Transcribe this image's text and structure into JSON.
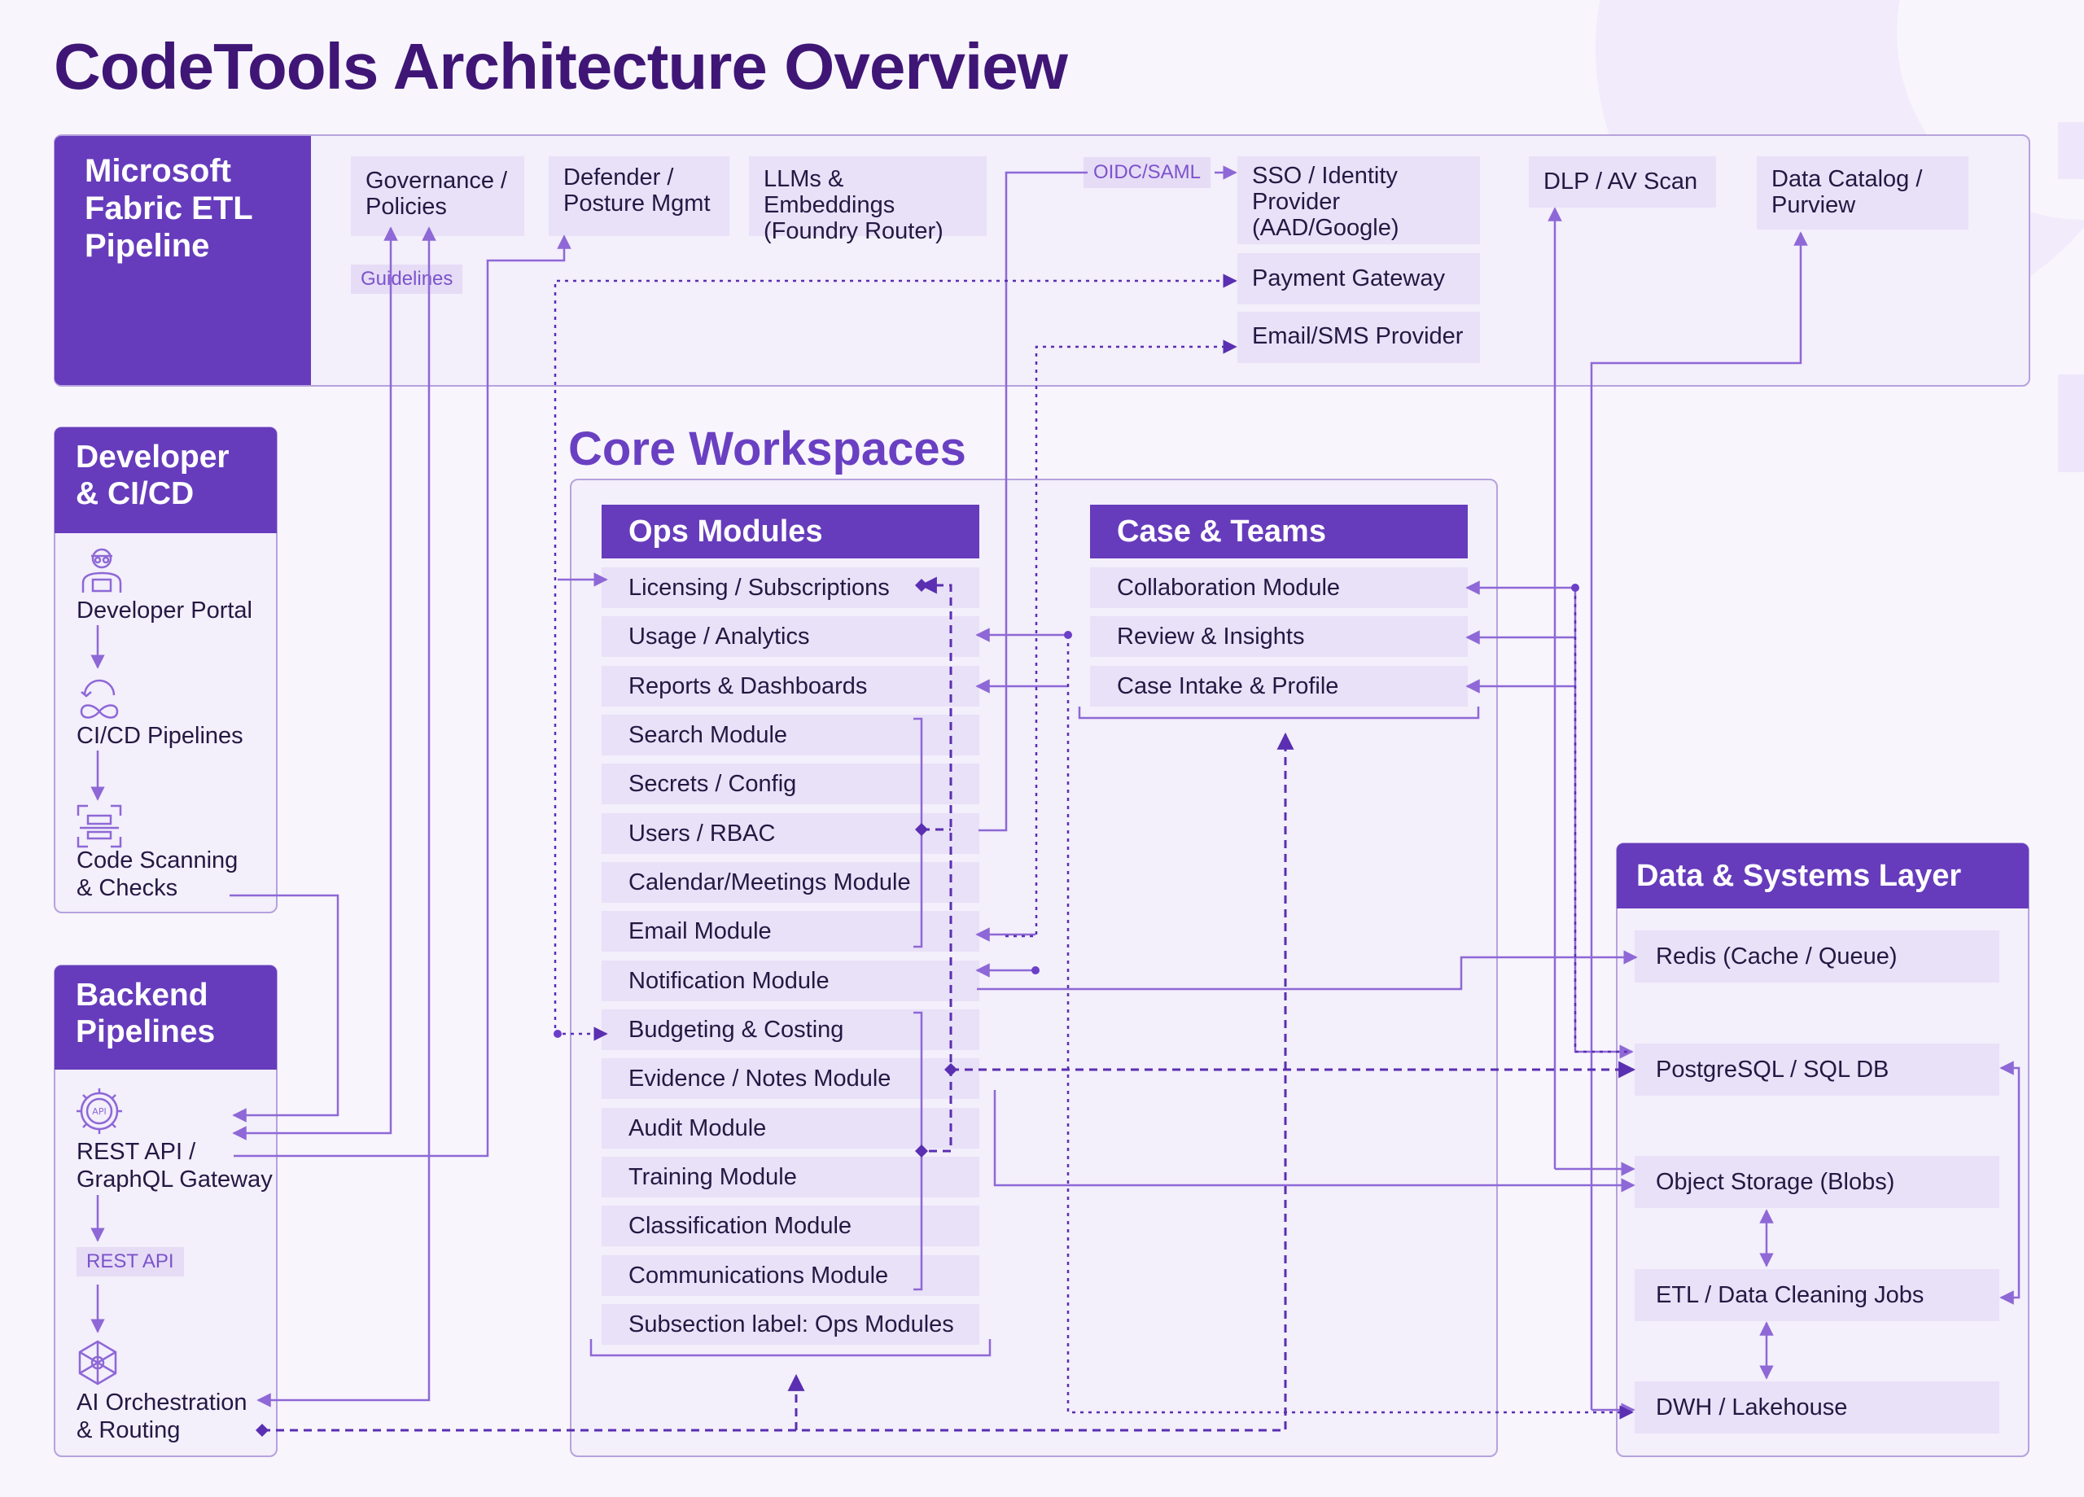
{
  "title": "CodeTools Architecture Overview",
  "fabric": {
    "title": "Microsoft Fabric ETL Pipeline",
    "title_lines": [
      "Microsoft",
      "Fabric ETL",
      "Pipeline"
    ],
    "cards": {
      "governance": "Governance / Policies",
      "governance_lines": [
        "Governance /",
        "Policies"
      ],
      "defender": "Defender / Posture Mgmt",
      "defender_lines": [
        "Defender /",
        "Posture Mgmt"
      ],
      "llms": "LLMs & Embeddings (Foundry Router)",
      "llms_lines": [
        "LLMs & Embeddings",
        "(Foundry Router)"
      ],
      "sso": "SSO / Identity Provider (AAD/Google)",
      "sso_lines": [
        "SSO / Identity",
        "Provider",
        "(AAD/Google)"
      ],
      "payment": "Payment Gateway",
      "email_sms": "Email/SMS Provider",
      "dlp": "DLP / AV Scan",
      "catalog": "Data Catalog / Purview",
      "catalog_lines": [
        "Data Catalog /",
        "Purview"
      ]
    },
    "chips": {
      "guidelines": "Guidelines",
      "oidc": "OIDC/SAML"
    }
  },
  "developer": {
    "title": "Developer & CI/CD",
    "title_lines": [
      "Developer",
      "& CI/CD"
    ],
    "items": [
      "Developer Portal",
      "CI/CD Pipelines",
      "Code Scanning & Checks"
    ],
    "code_scanning_lines": [
      "Code Scanning",
      "& Checks"
    ]
  },
  "backend": {
    "title": "Backend Pipelines",
    "title_lines": [
      "Backend",
      "Pipelines"
    ],
    "gateway": "REST API / GraphQL Gateway",
    "gateway_lines": [
      "REST API /",
      "GraphQL Gateway"
    ],
    "rest_api_chip": "REST API",
    "ai": "AI Orchestration & Routing",
    "ai_lines": [
      "AI Orchestration",
      "& Routing"
    ]
  },
  "core": {
    "title": "Core Workspaces",
    "ops": {
      "header": "Ops Modules",
      "items": [
        "Licensing / Subscriptions",
        "Usage / Analytics",
        "Reports & Dashboards",
        "Search Module",
        "Secrets / Config",
        "Users / RBAC",
        "Calendar/Meetings Module",
        "Email Module",
        "Notification Module",
        "Budgeting & Costing",
        "Evidence / Notes Module",
        "Audit Module",
        "Training Module",
        "Classification Module",
        "Communications Module",
        "Subsection label: Ops Modules"
      ]
    },
    "case": {
      "header": "Case & Teams",
      "items": [
        "Collaboration Module",
        "Review & Insights",
        "Case Intake & Profile"
      ]
    }
  },
  "data_layer": {
    "header": "Data & Systems Layer",
    "items": [
      "Redis (Cache / Queue)",
      "PostgreSQL / SQL DB",
      "Object Storage (Blobs)",
      "ETL / Data Cleaning Jobs",
      "DWH / Lakehouse"
    ]
  },
  "colors": {
    "primary": "#663cbc",
    "title": "#3f1676",
    "card": "#e9e1f8",
    "panel": "#f3effb",
    "border": "#b6a3dd",
    "line": "#8e68d6",
    "dashed": "#5a2fb1"
  },
  "icons": [
    "developer-icon",
    "cicd-icon",
    "scan-icon",
    "api-icon",
    "network-icon"
  ]
}
